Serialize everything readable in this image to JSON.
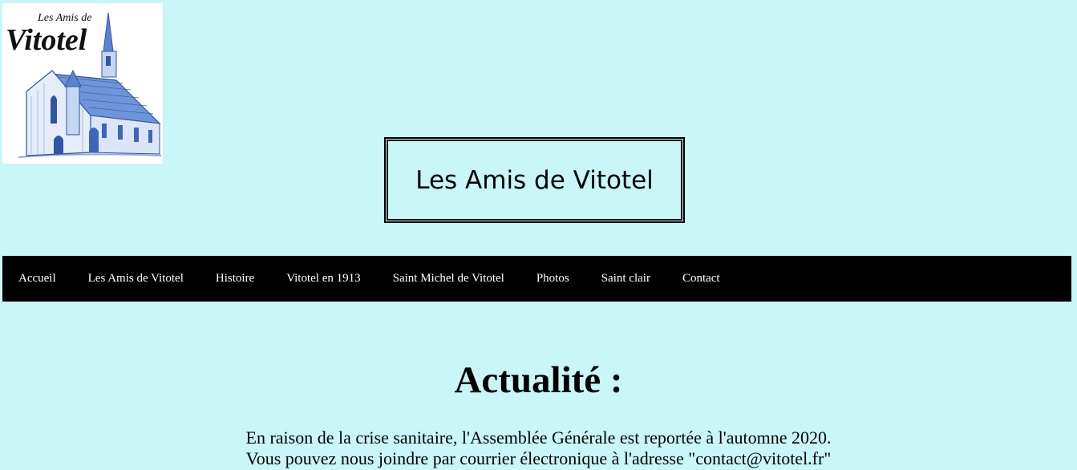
{
  "header": {
    "logo_text_small": "Les Amis de",
    "logo_text_large": "Vitotel",
    "site_title": "Les Amis de Vitotel"
  },
  "nav": {
    "items": [
      {
        "label": "Accueil"
      },
      {
        "label": "Les Amis de Vitotel"
      },
      {
        "label": "Histoire"
      },
      {
        "label": "Vitotel en 1913"
      },
      {
        "label": "Saint Michel de Vitotel"
      },
      {
        "label": "Photos"
      },
      {
        "label": "Saint clair"
      },
      {
        "label": "Contact"
      }
    ]
  },
  "main": {
    "heading": "Actualité :",
    "lines": [
      "En raison de la crise sanitaire, l'Assemblée Générale est reportée à l'automne 2020.",
      "Vous pouvez nous joindre par courrier électronique à l'adresse \"contact@vitotel.fr\""
    ]
  },
  "colors": {
    "background": "#c9f6f6",
    "navbar": "#000000",
    "nav_text": "#ffffff",
    "logo_ink": "#4a78c8"
  }
}
